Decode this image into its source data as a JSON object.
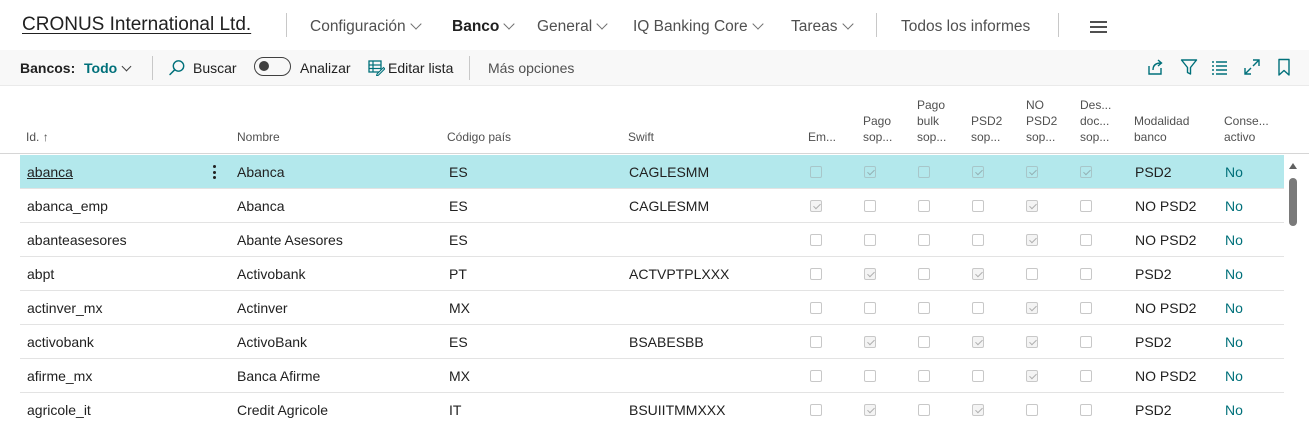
{
  "app": {
    "company": "CRONUS International Ltd.",
    "nav": [
      {
        "label": "Configuración",
        "has_dropdown": true,
        "active": false
      },
      {
        "label": "Banco",
        "has_dropdown": true,
        "active": true
      },
      {
        "label": "General",
        "has_dropdown": true,
        "active": false
      },
      {
        "label": "IQ Banking Core",
        "has_dropdown": true,
        "active": false
      },
      {
        "label": "Tareas",
        "has_dropdown": true,
        "active": false
      }
    ],
    "all_reports": "Todos los informes",
    "menu_icon": "hamburger-menu-icon"
  },
  "actionbar": {
    "filter_label": "Bancos:",
    "filter_value": "Todo",
    "search": "Buscar",
    "analyze": "Analizar",
    "analyze_on": false,
    "edit_list": "Editar lista",
    "more_options": "Más opciones",
    "right_icons": [
      "share-icon",
      "filter-icon",
      "list-view-icon",
      "expand-icon",
      "bookmark-icon"
    ]
  },
  "table": {
    "columns": {
      "id": "Id.",
      "id_sort": "↑",
      "name": "Nombre",
      "country": "Código país",
      "swift": "Swift",
      "em": "Em...",
      "pago": [
        "Pago",
        "sop..."
      ],
      "pago_bulk": [
        "Pago",
        "bulk",
        "sop..."
      ],
      "psd2": [
        "PSD2",
        "sop..."
      ],
      "no_psd2": [
        "NO",
        "PSD2",
        "sop..."
      ],
      "des": [
        "Des...",
        "doc...",
        "sop..."
      ],
      "modalidad": [
        "Modalidad",
        "banco"
      ],
      "conse": [
        "Conse...",
        "activo"
      ]
    },
    "rows": [
      {
        "id": "abanca",
        "name": "Abanca",
        "country": "ES",
        "swift": "CAGLESMM",
        "em": false,
        "pago": true,
        "pago_bulk": false,
        "psd2": true,
        "no_psd2": true,
        "des": true,
        "modalidad": "PSD2",
        "activo": "No",
        "selected": true
      },
      {
        "id": "abanca_emp",
        "name": "Abanca",
        "country": "ES",
        "swift": "CAGLESMM",
        "em": true,
        "pago": false,
        "pago_bulk": false,
        "psd2": false,
        "no_psd2": true,
        "des": false,
        "modalidad": "NO PSD2",
        "activo": "No",
        "selected": false
      },
      {
        "id": "abanteasesores",
        "name": "Abante Asesores",
        "country": "ES",
        "swift": "",
        "em": false,
        "pago": false,
        "pago_bulk": false,
        "psd2": false,
        "no_psd2": true,
        "des": false,
        "modalidad": "NO PSD2",
        "activo": "No",
        "selected": false
      },
      {
        "id": "abpt",
        "name": "Activobank",
        "country": "PT",
        "swift": "ACTVPTPLXXX",
        "em": false,
        "pago": true,
        "pago_bulk": false,
        "psd2": true,
        "no_psd2": false,
        "des": false,
        "modalidad": "PSD2",
        "activo": "No",
        "selected": false
      },
      {
        "id": "actinver_mx",
        "name": "Actinver",
        "country": "MX",
        "swift": "",
        "em": false,
        "pago": false,
        "pago_bulk": false,
        "psd2": false,
        "no_psd2": true,
        "des": false,
        "modalidad": "NO PSD2",
        "activo": "No",
        "selected": false
      },
      {
        "id": "activobank",
        "name": "ActivoBank",
        "country": "ES",
        "swift": "BSABESBB",
        "em": false,
        "pago": true,
        "pago_bulk": false,
        "psd2": true,
        "no_psd2": true,
        "des": false,
        "modalidad": "PSD2",
        "activo": "No",
        "selected": false
      },
      {
        "id": "afirme_mx",
        "name": "Banca Afirme",
        "country": "MX",
        "swift": "",
        "em": false,
        "pago": false,
        "pago_bulk": false,
        "psd2": false,
        "no_psd2": true,
        "des": false,
        "modalidad": "NO PSD2",
        "activo": "No",
        "selected": false
      },
      {
        "id": "agricole_it",
        "name": "Credit Agricole",
        "country": "IT",
        "swift": "BSUIITMMXXX",
        "em": false,
        "pago": true,
        "pago_bulk": false,
        "psd2": true,
        "no_psd2": false,
        "des": false,
        "modalidad": "PSD2",
        "activo": "No",
        "selected": false
      }
    ]
  },
  "colors": {
    "accent": "#00707a",
    "selected_row": "#b3e8ec",
    "actionbar_bg": "#f8f8f8"
  }
}
